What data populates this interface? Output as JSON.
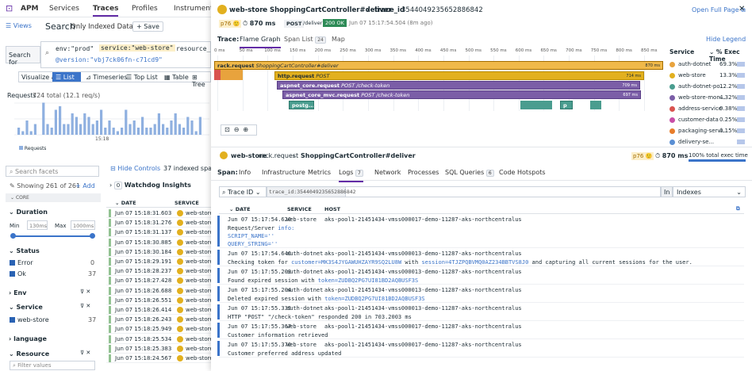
{
  "nav": {
    "brand": "APM",
    "items": [
      "Services",
      "Traces",
      "Profiles",
      "Instrumentat"
    ]
  },
  "toolbar": {
    "views": "Views",
    "search_label": "Search",
    "search_mode": "Only Indexed Data",
    "save": "Save"
  },
  "query": {
    "search_for": "Search for",
    "line1_a": "env:\"prod\"",
    "line1_b": "service:\"web-store\"",
    "line1_c": "resource_n",
    "line2": "@version:\"vbj7ck06fn-c71cd9\""
  },
  "viz": {
    "label": "Visualize as",
    "tabs": [
      "List",
      "Timeseries",
      "Top List",
      "Table",
      "Tree"
    ]
  },
  "requests": {
    "label": "Requests",
    "total": "724 total (12.1 req/s)",
    "xtick": "15:18",
    "legend": "Requests",
    "yticks": [
      "10",
      "5",
      "0"
    ]
  },
  "facets": {
    "search_placeholder": "Search facets",
    "showing": "Showing 261 of 261",
    "add": "Add",
    "core": "CORE",
    "duration": {
      "title": "Duration",
      "min_label": "Min",
      "min_val": "130ms",
      "max_label": "Max",
      "max_val": "1000ms"
    },
    "status": {
      "title": "Status",
      "items": [
        {
          "label": "Error",
          "count": "0"
        },
        {
          "label": "Ok",
          "count": "37"
        }
      ]
    },
    "env": "Env",
    "service": {
      "title": "Service",
      "items": [
        {
          "label": "web-store",
          "count": "37"
        }
      ]
    },
    "language": "language",
    "resource": "Resource",
    "filter_placeholder": "Filter values"
  },
  "list": {
    "hide_controls": "Hide Controls",
    "indexed": "37 indexed spans",
    "watchdog_count": "0",
    "watchdog": "Watchdog Insights",
    "col_date": "DATE",
    "col_service": "SERVICE",
    "rows": [
      {
        "date": "Jun 07 15:18:31.603",
        "svc": "web-store"
      },
      {
        "date": "Jun 07 15:18:31.276",
        "svc": "web-store"
      },
      {
        "date": "Jun 07 15:18:31.137",
        "svc": "web-store"
      },
      {
        "date": "Jun 07 15:18:30.885",
        "svc": "web-store"
      },
      {
        "date": "Jun 07 15:18:30.184",
        "svc": "web-store"
      },
      {
        "date": "Jun 07 15:18:29.191",
        "svc": "web-store"
      },
      {
        "date": "Jun 07 15:18:28.237",
        "svc": "web-store"
      },
      {
        "date": "Jun 07 15:18:27.428",
        "svc": "web-store"
      },
      {
        "date": "Jun 07 15:18:26.688",
        "svc": "web-store"
      },
      {
        "date": "Jun 07 15:18:26.551",
        "svc": "web-store"
      },
      {
        "date": "Jun 07 15:18:26.414",
        "svc": "web-store"
      },
      {
        "date": "Jun 07 15:18:26.243",
        "svc": "web-store"
      },
      {
        "date": "Jun 07 15:18:25.949",
        "svc": "web-store"
      },
      {
        "date": "Jun 07 15:18:25.534",
        "svc": "web-store"
      },
      {
        "date": "Jun 07 15:18:25.383",
        "svc": "web-store"
      },
      {
        "date": "Jun 07 15:18:24.567",
        "svc": "web-store"
      }
    ]
  },
  "panel": {
    "crumb_svc": "web-store",
    "crumb_res": "ShoppingCartController#deliver",
    "crumb_trace": "trace_id",
    "trace_id": "3544049235652886842",
    "open_full": "Open Full Page",
    "p76": "p76",
    "duration": "870 ms",
    "method": "POST",
    "path": "/deliver",
    "status": "200 OK",
    "time": "Jun 07 15:17:54.504 (8m ago)",
    "trace_label": "Trace:",
    "tabs": [
      "Flame Graph",
      "Span List",
      "Map"
    ],
    "span_count": "24",
    "hide_legend": "Hide Legend",
    "legend_service": "Service",
    "legend_exec": "% Exec Time",
    "ticks": [
      "0 ms",
      "50 ms",
      "100 ms",
      "150 ms",
      "200 ms",
      "250 ms",
      "300 ms",
      "350 ms",
      "400 ms",
      "450 ms",
      "500 ms",
      "550 ms",
      "600 ms",
      "650 ms",
      "700 ms",
      "750 ms",
      "800 ms",
      "850 ms"
    ],
    "spans": [
      {
        "name": "rack.request",
        "res": "ShoppingCartController#deliver",
        "dur": "870 ms"
      },
      {
        "name": "http.request",
        "res": "POST",
        "dur": "714 ms"
      },
      {
        "name": "aspnet_core.request",
        "res": "POST /check-token",
        "dur": "709 ms"
      },
      {
        "name": "aspnet_core_mvc.request",
        "res": "POST /check-token",
        "dur": "697 ms"
      },
      {
        "name": "postg..."
      },
      {
        "name": "p"
      }
    ],
    "services": [
      {
        "name": "auth-dotnet",
        "pct": "69.3%",
        "color": "#e8a33d"
      },
      {
        "name": "web-store",
        "pct": "13.3%",
        "color": "#e2b01f"
      },
      {
        "name": "auth-dotnet-po...",
        "pct": "12.2%",
        "color": "#4a9d8f"
      },
      {
        "name": "web-store-mon...",
        "pct": "4.32%",
        "color": "#7b5ea7"
      },
      {
        "name": "address-service",
        "pct": "0.38%",
        "color": "#d9534f"
      },
      {
        "name": "customer-data",
        "pct": "0.25%",
        "color": "#c84ea7"
      },
      {
        "name": "packaging-servi...",
        "pct": "0.15%",
        "color": "#e87d2a"
      },
      {
        "name": "delivery-se...",
        "pct": "",
        "color": "#5a8fd4"
      }
    ],
    "span_bar": {
      "svc": "web-store",
      "op": "rack.request",
      "res": "ShoppingCartController#deliver",
      "p76": "p76",
      "dur": "870 ms",
      "exec": "100% total exec time"
    },
    "span_label": "Span:",
    "span_tabs": [
      "Info",
      "Infrastructure",
      "Metrics",
      "Logs",
      "Network",
      "Processes",
      "SQL Queries",
      "Code Hotspots"
    ],
    "logs_count": "7",
    "sql_count": "6",
    "filter_label": "Trace ID",
    "filter_val": "trace_id:3544049235652886842",
    "in_label": "In",
    "index": "Indexes",
    "log_cols": [
      "DATE",
      "SERVICE",
      "HOST"
    ],
    "logs": [
      {
        "date": "Jun 07 15:17:54.620",
        "svc": "web-store",
        "host": "aks-pool1-21451434-vmss000017-demo-11287-aks-northcentralus",
        "lines": [
          "Request/Server info:",
          "SCRIPT_NAME=''",
          "QUERY_STRING=''"
        ]
      },
      {
        "date": "Jun 07 15:17:54.646",
        "svc": "auth-dotnet",
        "host": "aks-pool1-21451434-vmss000013-demo-11287-aks-northcentralus",
        "lines": [
          "Checking token for customer=MK3S4JYGAWUHZAYR9SQ2LU8W with session=4TJZPQBVMQ0AZ234BBTVS8J0 and capturing all current sessions for the user."
        ]
      },
      {
        "date": "Jun 07 15:17:55.203",
        "svc": "auth-dotnet",
        "host": "aks-pool1-21451434-vmss000013-demo-11287-aks-northcentralus",
        "lines": [
          "Found expired session with token=ZUDBQ2PG7UI81BD2AQBUSF3S"
        ]
      },
      {
        "date": "Jun 07 15:17:55.204",
        "svc": "auth-dotnet",
        "host": "aks-pool1-21451434-vmss000013-demo-11287-aks-northcentralus",
        "lines": [
          "Deleted expired session with token=ZUDBQ2PG7UI81BD2AQBUSF3S"
        ]
      },
      {
        "date": "Jun 07 15:17:55.335",
        "svc": "auth-dotnet",
        "host": "aks-pool1-21451434-vmss000013-demo-11287-aks-northcentralus",
        "lines": [
          "HTTP \"POST\" \"/check-token\" responded 200 in 703.2003 ms"
        ]
      },
      {
        "date": "Jun 07 15:17:55.367",
        "svc": "web-store",
        "host": "aks-pool1-21451434-vmss000017-demo-11287-aks-northcentralus",
        "lines": [
          "Customer information retrieved"
        ]
      },
      {
        "date": "Jun 07 15:17:55.370",
        "svc": "web-store",
        "host": "aks-pool1-21451434-vmss000017-demo-11287-aks-northcentralus",
        "lines": [
          "Customer preferred address updated"
        ]
      }
    ]
  }
}
